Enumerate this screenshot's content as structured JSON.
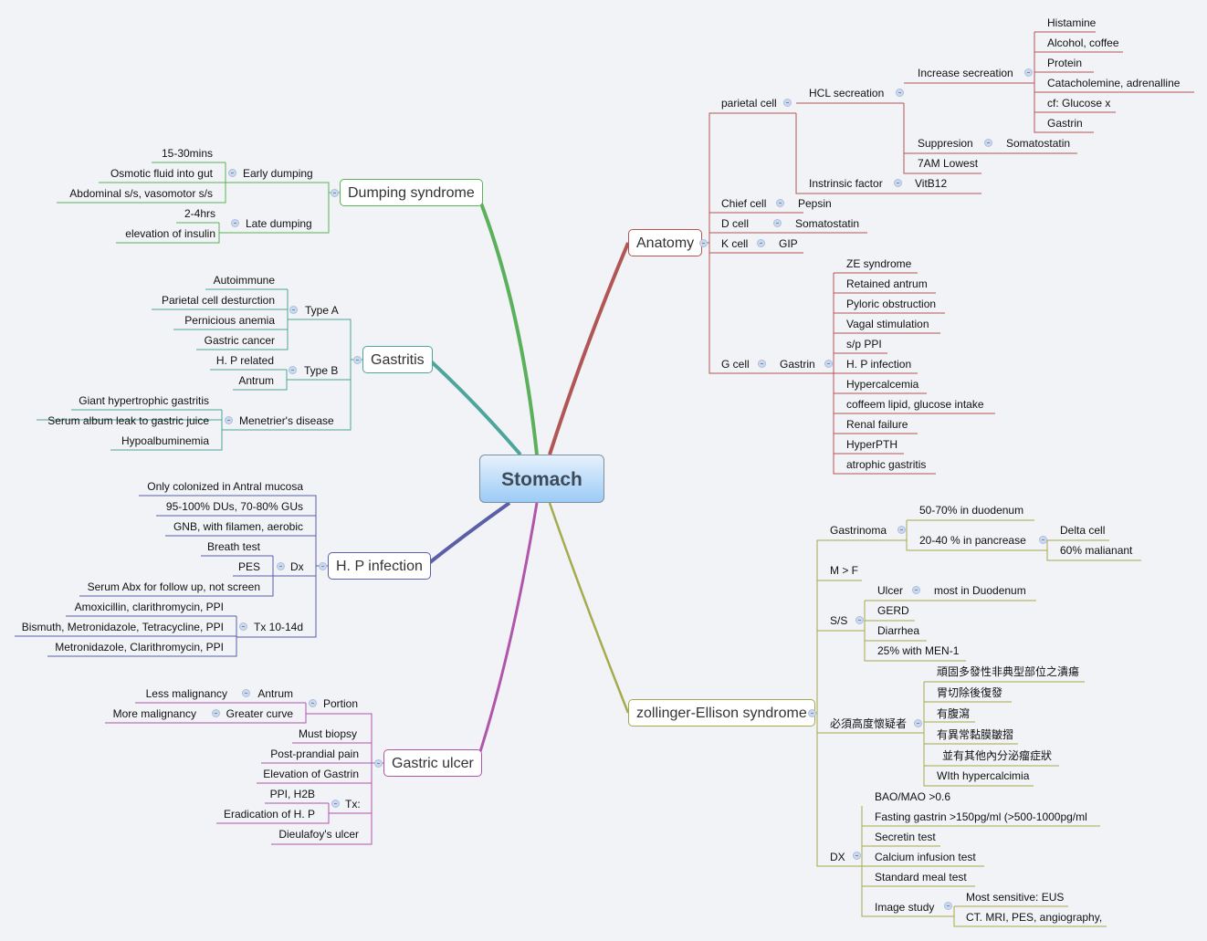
{
  "central": "Stomach",
  "colors": {
    "dumping": "#5bb15b",
    "gastritis": "#4ea59b",
    "hp": "#5b5fa8",
    "ulcer": "#b055a9",
    "anatomy": "#b25555",
    "ze": "#a6aa4f"
  },
  "dumping": {
    "title": "Dumping syndrome",
    "early": {
      "label": "Early dumping",
      "items": [
        "15-30mins",
        "Osmotic  fluid into gut",
        "Abdominal s/s, vasomotor s/s"
      ]
    },
    "late": {
      "label": "Late dumping",
      "items": [
        "2-4hrs",
        "elevation of insulin"
      ]
    }
  },
  "gastritis": {
    "title": "Gastritis",
    "typeA": {
      "label": "Type A",
      "items": [
        "Autoimmune",
        "Parietal cell desturction",
        "Pernicious anemia",
        "Gastric cancer"
      ]
    },
    "typeB": {
      "label": "Type B",
      "items": [
        "H. P related",
        "Antrum"
      ]
    },
    "menetrier": {
      "label": "Menetrier's disease",
      "items": [
        "Giant hypertrophic gastritis",
        "Serum album leak to gastric juice",
        "Hypoalbuminemia"
      ]
    }
  },
  "hp": {
    "title": "H. P infection",
    "items": [
      "Only colonized in Antral mucosa",
      "95-100% DUs, 70-80% GUs",
      "GNB, with filamen, aerobic"
    ],
    "dx": {
      "label": "Dx",
      "items": [
        "Breath test",
        "PES",
        "Serum Abx for follow up, not screen"
      ]
    },
    "tx": {
      "label": "Tx 10-14d",
      "items": [
        "Amoxicillin, clarithromycin, PPI",
        "Bismuth, Metronidazole, Tetracycline, PPI",
        "Metronidazole, Clarithromycin, PPI"
      ]
    }
  },
  "ulcer": {
    "title": "Gastric ulcer",
    "portion": {
      "label": "Portion",
      "antrum": {
        "label": "Antrum",
        "item": "Less malignancy"
      },
      "greater": {
        "label": "Greater curve",
        "item": "More malignancy"
      }
    },
    "items": [
      "Must biopsy",
      "Post-prandial pain",
      "Elevation of Gastrin"
    ],
    "tx": {
      "label": "Tx:",
      "items": [
        "PPI, H2B",
        "Eradication of H. P"
      ]
    },
    "last": "Dieulafoy's ulcer"
  },
  "anatomy": {
    "title": "Anatomy",
    "parietal": {
      "label": "parietal cell",
      "hcl": {
        "label": "HCL secreation",
        "increase": {
          "label": "Increase secreation",
          "items": [
            "Histamine",
            "Alcohol, coffee",
            "Protein",
            "Catacholemine, adrenalline",
            "cf: Glucose x",
            "Gastrin"
          ]
        },
        "suppresion": {
          "label": "Suppresion",
          "item": "Somatostatin"
        },
        "lowest": "7AM Lowest"
      },
      "intrinsic": {
        "label": "Instrinsic factor",
        "item": "VitB12"
      }
    },
    "chief": {
      "label": "Chief cell",
      "item": "Pepsin"
    },
    "dcell": {
      "label": "D cell",
      "item": "Somatostatin"
    },
    "kcell": {
      "label": "K cell",
      "item": "GIP"
    },
    "gcell": {
      "label": "G cell",
      "gastrin": "Gastrin",
      "items": [
        "ZE syndrome",
        "Retained antrum",
        "Pyloric obstruction",
        "Vagal stimulation",
        "s/p PPI",
        "H. P infection",
        "Hypercalcemia",
        "coffeem lipid, glucose intake",
        "Renal failure",
        "HyperPTH",
        "atrophic gastritis"
      ]
    }
  },
  "ze": {
    "title": "zollinger-Ellison syndrome",
    "gastrinoma": {
      "label": "Gastrinoma",
      "duodenum": "50-70% in duodenum",
      "pancreas": {
        "label": "20-40 % in pancrease",
        "items": [
          "Delta cell",
          "60% malianant"
        ]
      }
    },
    "mf": "M > F",
    "ss": {
      "label": "S/S",
      "ulcer": {
        "label": "Ulcer",
        "item": "most in Duodenum"
      },
      "items": [
        "GERD",
        "Diarrhea",
        "25% with MEN-1"
      ]
    },
    "suspect": {
      "label": "必須高度懷疑者",
      "items": [
        "頑固多發性非典型部位之潰瘍",
        "胃切除後復發",
        "有腹瀉",
        "有異常黏膜皺摺",
        "並有其他內分泌瘤症狀",
        "WIth hypercalcimia"
      ]
    },
    "dx": {
      "label": "DX",
      "items": [
        "BAO/MAO >0.6",
        "Fasting gastrin >150pg/ml (>500-1000pg/ml",
        "Secretin test",
        "Calcium infusion test",
        "Standard meal test"
      ],
      "image": {
        "label": "Image study",
        "items": [
          "Most sensitive: EUS",
          "CT. MRI, PES, angiography,"
        ]
      }
    }
  }
}
